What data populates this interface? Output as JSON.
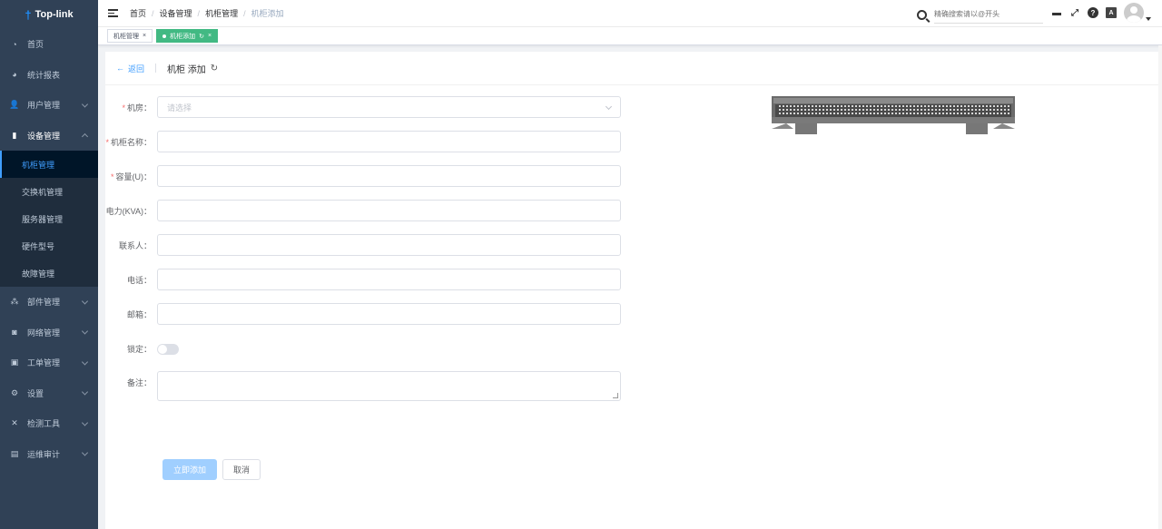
{
  "app": {
    "logo_text": "Top-link"
  },
  "sidebar": {
    "items": [
      {
        "label": "首页",
        "icon": "dashboard-icon",
        "expandable": false
      },
      {
        "label": "统计报表",
        "icon": "pie-chart-icon",
        "expandable": false
      },
      {
        "label": "用户管理",
        "icon": "user-icon",
        "expandable": true
      },
      {
        "label": "设备管理",
        "icon": "device-icon",
        "expandable": true,
        "expanded": true
      }
    ],
    "submenu": [
      {
        "label": "机柜管理",
        "active": true
      },
      {
        "label": "交换机管理"
      },
      {
        "label": "服务器管理"
      },
      {
        "label": "硬件型号"
      },
      {
        "label": "故障管理"
      }
    ],
    "items_after": [
      {
        "label": "部件管理",
        "icon": "component-icon"
      },
      {
        "label": "网络管理",
        "icon": "network-icon"
      },
      {
        "label": "工单管理",
        "icon": "ticket-icon"
      },
      {
        "label": "设置",
        "icon": "gear-icon"
      },
      {
        "label": "检测工具",
        "icon": "tool-icon"
      },
      {
        "label": "运维审计",
        "icon": "audit-icon"
      }
    ]
  },
  "breadcrumb": [
    "首页",
    "设备管理",
    "机柜管理",
    "机柜添加"
  ],
  "search": {
    "placeholder": "精确搜索请以@开头"
  },
  "tags": [
    {
      "label": "机柜管理",
      "active": false
    },
    {
      "label": "机柜添加",
      "active": true
    }
  ],
  "page": {
    "back_label": "返回",
    "title": "机柜 添加"
  },
  "form": {
    "room": {
      "label": "机房：",
      "placeholder": "请选择",
      "required": true
    },
    "name": {
      "label": "机柜名称：",
      "required": true
    },
    "capacity": {
      "label": "容量(U)：",
      "required": true
    },
    "power": {
      "label": "电力(KVA)："
    },
    "contact": {
      "label": "联系人："
    },
    "phone": {
      "label": "电话："
    },
    "email": {
      "label": "邮箱："
    },
    "lock": {
      "label": "锁定：",
      "value": false
    },
    "remark": {
      "label": "备注："
    },
    "submit_label": "立即添加",
    "cancel_label": "取消"
  },
  "colors": {
    "sidebar_bg": "#304156",
    "accent": "#409eff",
    "tag_active": "#42b983",
    "submit_disabled": "#a0cfff",
    "required": "#f56c6c"
  }
}
